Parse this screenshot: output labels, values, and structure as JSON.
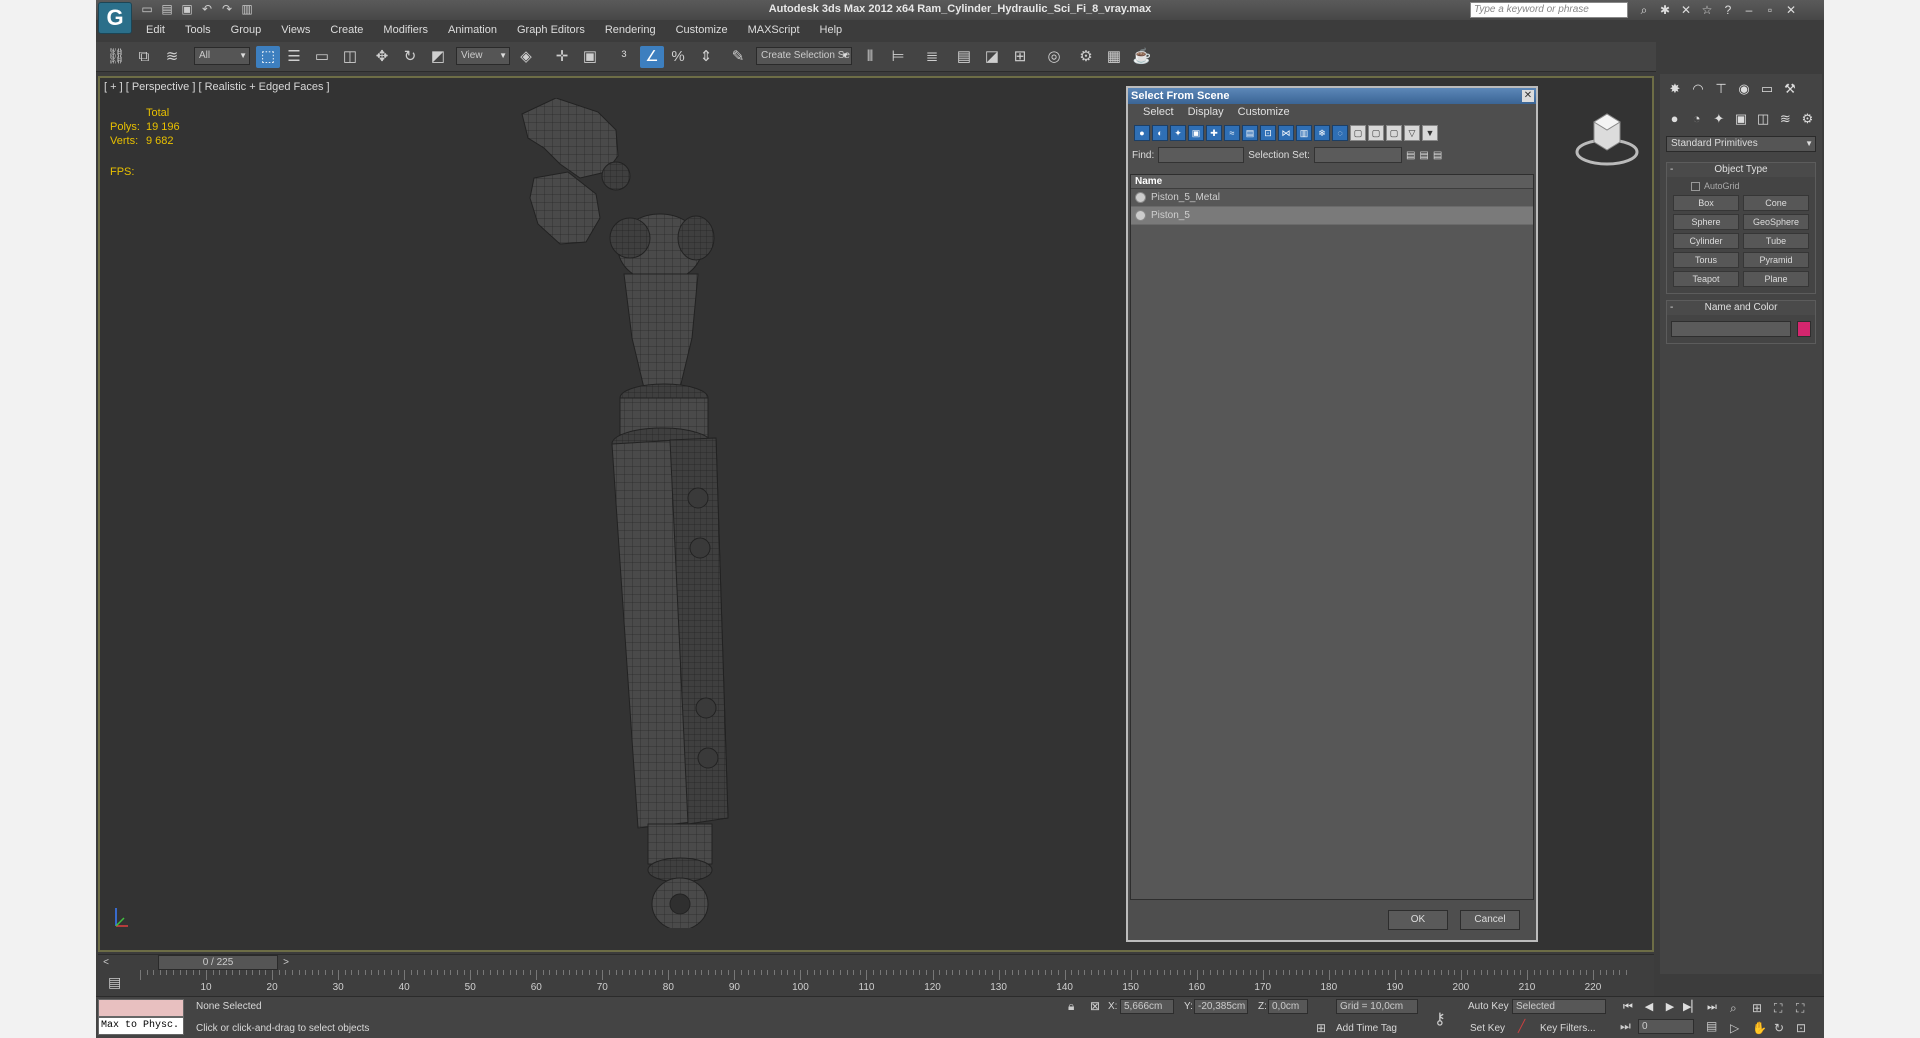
{
  "titlebar": {
    "title": "Autodesk 3ds Max  2012 x64      Ram_Cylinder_Hydraulic_Sci_Fi_8_vray.max",
    "search_placeholder": "Type a keyword or phrase",
    "logo": "G"
  },
  "menubar": [
    "Edit",
    "Tools",
    "Group",
    "Views",
    "Create",
    "Modifiers",
    "Animation",
    "Graph Editors",
    "Rendering",
    "Customize",
    "MAXScript",
    "Help"
  ],
  "toolbar": {
    "filter_value": "All",
    "refcoord_value": "View",
    "selection_set_value": "Create Selection Se"
  },
  "viewport": {
    "label": "[ + ] [ Perspective ] [ Realistic + Edged Faces ]",
    "stats_header": "Total",
    "polys_label": "Polys:",
    "polys_value": "19 196",
    "verts_label": "Verts:",
    "verts_value": "9 682",
    "fps_label": "FPS:"
  },
  "dialog": {
    "title": "Select From Scene",
    "menu": [
      "Select",
      "Display",
      "Customize"
    ],
    "find_label": "Find:",
    "selection_set_label": "Selection Set:",
    "column_header": "Name",
    "rows": [
      {
        "name": "Piston_5_Metal",
        "selected": false
      },
      {
        "name": "Piston_5",
        "selected": true
      }
    ],
    "ok_label": "OK",
    "cancel_label": "Cancel"
  },
  "command_panel": {
    "category_value": "Standard Primitives",
    "object_type_title": "Object Type",
    "autogrid_label": "AutoGrid",
    "objects": [
      "Box",
      "Cone",
      "Sphere",
      "GeoSphere",
      "Cylinder",
      "Tube",
      "Torus",
      "Pyramid",
      "Teapot",
      "Plane"
    ],
    "name_color_title": "Name and Color",
    "swatch_color": "#d4266e"
  },
  "timeslider": {
    "frame_label": "0 / 225",
    "ticks": [
      "10",
      "20",
      "30",
      "40",
      "50",
      "60",
      "70",
      "80",
      "90",
      "100",
      "110",
      "120",
      "130",
      "140",
      "150",
      "160",
      "170",
      "180",
      "190",
      "200",
      "210",
      "220"
    ]
  },
  "status": {
    "maxscript_text": "Max to Physc.",
    "selection_status": "None Selected",
    "prompt": "Click or click-and-drag to select objects",
    "x_label": "X:",
    "x_value": "5,666cm",
    "y_label": "Y:",
    "y_value": "-20,385cm",
    "z_label": "Z:",
    "z_value": "0,0cm",
    "grid_text": "Grid = 10,0cm",
    "add_time_tag": "Add Time Tag",
    "auto_key": "Auto Key",
    "set_key": "Set Key",
    "key_mode_value": "Selected",
    "key_filters": "Key Filters...",
    "frame_value": "0"
  },
  "colors": {
    "viewport_bg": "#333333",
    "highlight": "#3d7fbf",
    "stats": "#e8c000"
  }
}
